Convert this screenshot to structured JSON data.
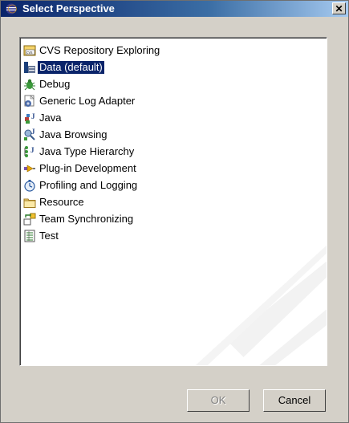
{
  "window": {
    "title": "Select Perspective",
    "close_label": "✕"
  },
  "perspectives": [
    {
      "label": "CVS Repository Exploring",
      "icon": "cvs-repository-icon",
      "selected": false
    },
    {
      "label": "Data (default)",
      "icon": "data-perspective-icon",
      "selected": true
    },
    {
      "label": "Debug",
      "icon": "debug-bug-icon",
      "selected": false
    },
    {
      "label": "Generic Log Adapter",
      "icon": "log-adapter-icon",
      "selected": false
    },
    {
      "label": "Java",
      "icon": "java-icon",
      "selected": false
    },
    {
      "label": "Java Browsing",
      "icon": "java-browsing-icon",
      "selected": false
    },
    {
      "label": "Java Type Hierarchy",
      "icon": "type-hierarchy-icon",
      "selected": false
    },
    {
      "label": "Plug-in Development",
      "icon": "plugin-icon",
      "selected": false
    },
    {
      "label": "Profiling and Logging",
      "icon": "profiling-icon",
      "selected": false
    },
    {
      "label": "Resource",
      "icon": "resource-folder-icon",
      "selected": false
    },
    {
      "label": "Team Synchronizing",
      "icon": "team-sync-icon",
      "selected": false
    },
    {
      "label": "Test",
      "icon": "test-icon",
      "selected": false
    }
  ],
  "buttons": {
    "ok_label": "OK",
    "ok_enabled": false,
    "cancel_label": "Cancel"
  },
  "colors": {
    "selection": "#0a246a",
    "title_start": "#0a246a",
    "dialog_bg": "#d4d0c8"
  }
}
